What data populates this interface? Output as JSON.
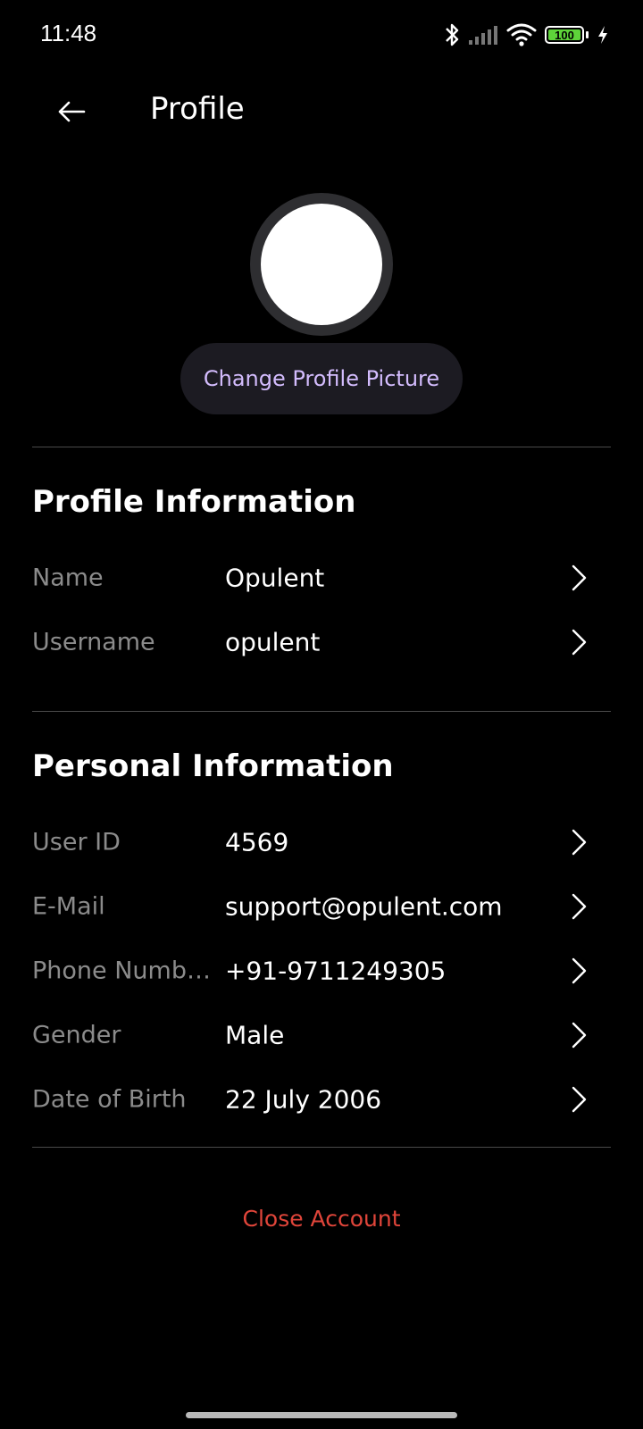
{
  "status_bar": {
    "time": "11:48",
    "battery_level": "100",
    "battery_color": "#5ed33a",
    "icons": [
      "bluetooth-icon",
      "signal-icon",
      "wifi-icon",
      "battery-icon",
      "charging-icon"
    ]
  },
  "app_bar": {
    "title": "Profile",
    "back_icon": "arrow-left-icon"
  },
  "avatar": {
    "change_label": "Change Profile Picture"
  },
  "profile_section": {
    "title": "Profile Information",
    "rows": [
      {
        "label": "Name",
        "value": "Opulent"
      },
      {
        "label": "Username",
        "value": "opulent"
      }
    ]
  },
  "personal_section": {
    "title": "Personal Information",
    "rows": [
      {
        "label": "User ID",
        "value": "4569"
      },
      {
        "label": "E-Mail",
        "value": "support@opulent.com"
      },
      {
        "label": "Phone Numb…",
        "value": "+91-9711249305"
      },
      {
        "label": "Gender",
        "value": "Male"
      },
      {
        "label": "Date of Birth",
        "value": "22 July 2006"
      }
    ]
  },
  "footer": {
    "close_account_label": "Close Account"
  },
  "colors": {
    "background": "#000000",
    "accent_text": "#d3bcfd",
    "danger": "#e0453a",
    "label_gray": "#8b8b8b"
  }
}
